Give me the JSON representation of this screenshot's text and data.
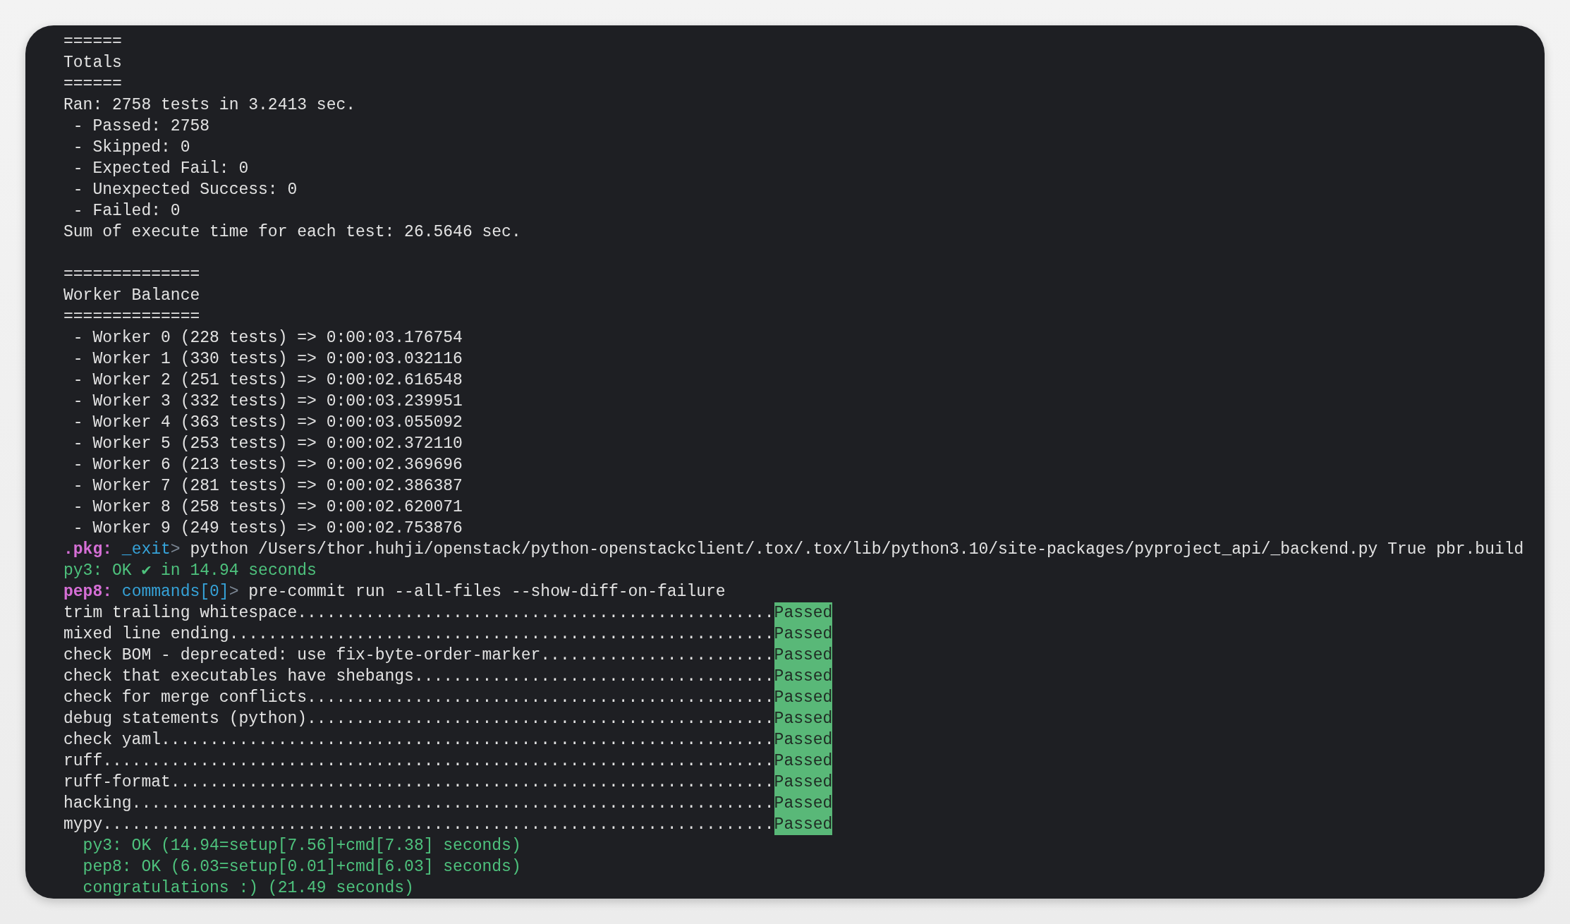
{
  "terminal": {
    "lines": [
      {
        "kind": "text",
        "text": "======"
      },
      {
        "kind": "text",
        "text": "Totals"
      },
      {
        "kind": "text",
        "text": "======"
      },
      {
        "kind": "text",
        "text": "Ran: 2758 tests in 3.2413 sec."
      },
      {
        "kind": "text",
        "text": " - Passed: 2758"
      },
      {
        "kind": "text",
        "text": " - Skipped: 0"
      },
      {
        "kind": "text",
        "text": " - Expected Fail: 0"
      },
      {
        "kind": "text",
        "text": " - Unexpected Success: 0"
      },
      {
        "kind": "text",
        "text": " - Failed: 0"
      },
      {
        "kind": "text",
        "text": "Sum of execute time for each test: 26.5646 sec."
      },
      {
        "kind": "blank"
      },
      {
        "kind": "text",
        "text": "=============="
      },
      {
        "kind": "text",
        "text": "Worker Balance"
      },
      {
        "kind": "text",
        "text": "=============="
      },
      {
        "kind": "text",
        "text": " - Worker 0 (228 tests) => 0:00:03.176754"
      },
      {
        "kind": "text",
        "text": " - Worker 1 (330 tests) => 0:00:03.032116"
      },
      {
        "kind": "text",
        "text": " - Worker 2 (251 tests) => 0:00:02.616548"
      },
      {
        "kind": "text",
        "text": " - Worker 3 (332 tests) => 0:00:03.239951"
      },
      {
        "kind": "text",
        "text": " - Worker 4 (363 tests) => 0:00:03.055092"
      },
      {
        "kind": "text",
        "text": " - Worker 5 (253 tests) => 0:00:02.372110"
      },
      {
        "kind": "text",
        "text": " - Worker 6 (213 tests) => 0:00:02.369696"
      },
      {
        "kind": "text",
        "text": " - Worker 7 (281 tests) => 0:00:02.386387"
      },
      {
        "kind": "text",
        "text": " - Worker 8 (258 tests) => 0:00:02.620071"
      },
      {
        "kind": "text",
        "text": " - Worker 9 (249 tests) => 0:00:02.753876"
      },
      {
        "kind": "prompt",
        "env": ".pkg:",
        "target": "_exit",
        "arrow": ">",
        "command": "python /Users/thor.huhji/openstack/python-openstackclient/.tox/.tox/lib/python3.10/site-packages/pyproject_api/_backend.py True pbr.build"
      },
      {
        "kind": "ok",
        "text": "py3: OK ✔ in 14.94 seconds"
      },
      {
        "kind": "prompt",
        "env": "pep8:",
        "target": "commands[0]",
        "arrow": ">",
        "command": "pre-commit run --all-files --show-diff-on-failure"
      },
      {
        "kind": "check",
        "text": "trim trailing whitespace.................................................",
        "status": "Passed"
      },
      {
        "kind": "check",
        "text": "mixed line ending........................................................",
        "status": "Passed"
      },
      {
        "kind": "check",
        "text": "check BOM - deprecated: use fix-byte-order-marker........................",
        "status": "Passed"
      },
      {
        "kind": "check",
        "text": "check that executables have shebangs.....................................",
        "status": "Passed"
      },
      {
        "kind": "check",
        "text": "check for merge conflicts................................................",
        "status": "Passed"
      },
      {
        "kind": "check",
        "text": "debug statements (python)................................................",
        "status": "Passed"
      },
      {
        "kind": "check",
        "text": "check yaml...............................................................",
        "status": "Passed"
      },
      {
        "kind": "check",
        "text": "ruff.....................................................................",
        "status": "Passed"
      },
      {
        "kind": "check",
        "text": "ruff-format..............................................................",
        "status": "Passed"
      },
      {
        "kind": "check",
        "text": "hacking..................................................................",
        "status": "Passed"
      },
      {
        "kind": "check",
        "text": "mypy.....................................................................",
        "status": "Passed"
      },
      {
        "kind": "ok",
        "text": "  py3: OK (14.94=setup[7.56]+cmd[7.38] seconds)"
      },
      {
        "kind": "ok",
        "text": "  pep8: OK (6.03=setup[0.01]+cmd[6.03] seconds)"
      },
      {
        "kind": "ok",
        "text": "  congratulations :) (21.49 seconds)"
      }
    ]
  }
}
